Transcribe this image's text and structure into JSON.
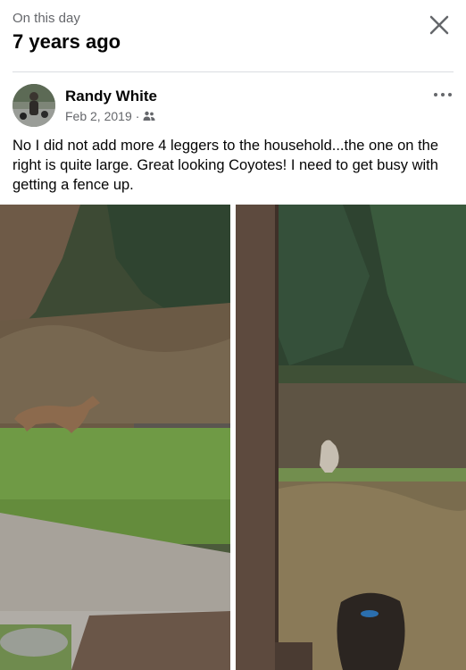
{
  "header": {
    "kicker": "On this day",
    "title": "7 years ago",
    "close_icon": "close-icon"
  },
  "post": {
    "author": "Randy White",
    "date": "Feb 2, 2019",
    "separator": "·",
    "audience_icon": "friends-icon",
    "more_icon": "more-options-icon",
    "text": "No I did not add more 4 leggers to the household...the one on the right is quite large. Great looking Coyotes! I need to get busy with getting a fence up."
  },
  "colors": {
    "text_primary": "#050505",
    "text_secondary": "#65676b",
    "divider": "#dadde1"
  }
}
